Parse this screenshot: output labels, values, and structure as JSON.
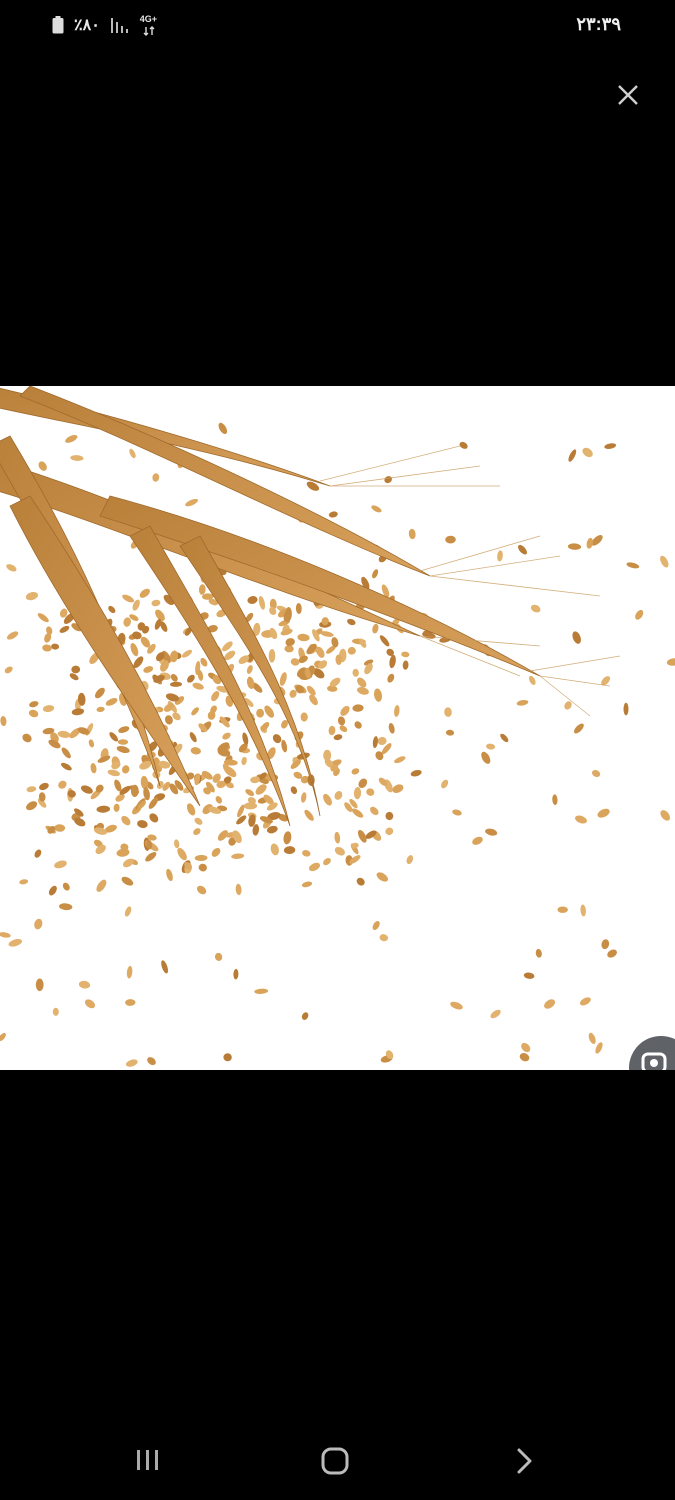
{
  "status_bar": {
    "battery_percent": "٪۸۰",
    "network_type": "4G+",
    "time": "۲۳:۳۹"
  },
  "icons": {
    "close": "close-icon",
    "lens": "google-lens-icon",
    "battery": "battery-icon",
    "signal": "signal-bars-icon",
    "network": "network-4g-icon",
    "recents": "recent-apps-icon",
    "home": "home-icon",
    "back": "back-icon"
  },
  "colors": {
    "background": "#000000",
    "photo_background": "#ffffff",
    "grain": "#d9a35a",
    "lens_button": "#5f6368"
  }
}
